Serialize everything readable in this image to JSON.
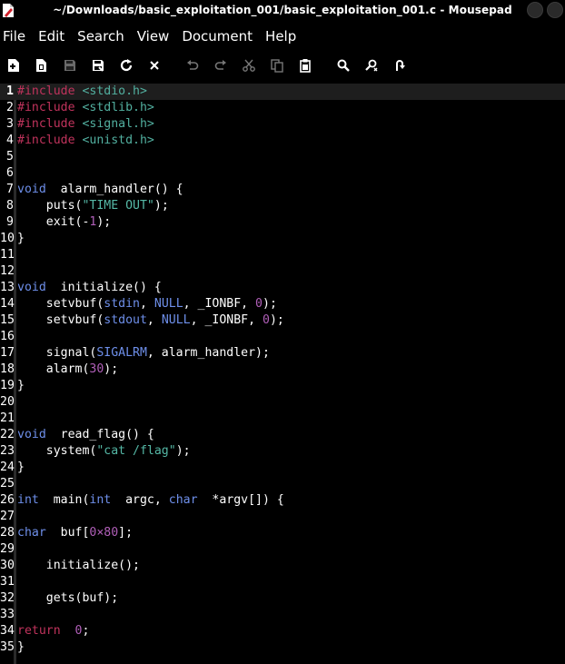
{
  "window": {
    "title": "~/Downloads/basic_exploitation_001/basic_exploitation_001.c - Mousepad"
  },
  "menu": [
    "File",
    "Edit",
    "Search",
    "View",
    "Document",
    "Help"
  ],
  "toolbar": {
    "buttons": [
      {
        "name": "new-document-icon"
      },
      {
        "name": "open-file-icon"
      },
      {
        "name": "save-icon"
      },
      {
        "name": "save-as-icon"
      },
      {
        "name": "reload-icon"
      },
      {
        "name": "close-icon"
      },
      {
        "name": "undo-icon"
      },
      {
        "name": "redo-icon"
      },
      {
        "name": "cut-icon"
      },
      {
        "name": "copy-icon"
      },
      {
        "name": "paste-icon"
      },
      {
        "name": "find-icon"
      },
      {
        "name": "find-replace-icon"
      },
      {
        "name": "go-to-line-icon"
      }
    ]
  },
  "editor": {
    "current_line": 1,
    "lines": [
      [
        [
          "pre",
          "#include "
        ],
        [
          "inc",
          "<stdio.h>"
        ]
      ],
      [
        [
          "pre",
          "#include "
        ],
        [
          "inc",
          "<stdlib.h>"
        ]
      ],
      [
        [
          "pre",
          "#include "
        ],
        [
          "inc",
          "<signal.h>"
        ]
      ],
      [
        [
          "pre",
          "#include "
        ],
        [
          "inc",
          "<unistd.h>"
        ]
      ],
      [],
      [],
      [
        [
          "kw",
          "void"
        ],
        [
          "",
          "  alarm_handler() {"
        ]
      ],
      [
        [
          "",
          "    puts("
        ],
        [
          "str",
          "\"TIME OUT\""
        ],
        [
          "",
          ");"
        ]
      ],
      [
        [
          "",
          "    exit(-"
        ],
        [
          "num",
          "1"
        ],
        [
          "",
          ");"
        ]
      ],
      [
        [
          "",
          "}"
        ]
      ],
      [],
      [],
      [
        [
          "kw",
          "void"
        ],
        [
          "",
          "  initialize() {"
        ]
      ],
      [
        [
          "",
          "    setvbuf("
        ],
        [
          "kw",
          "stdin"
        ],
        [
          "",
          ", "
        ],
        [
          "kw",
          "NULL"
        ],
        [
          "",
          ", _IONBF, "
        ],
        [
          "num",
          "0"
        ],
        [
          "",
          ");"
        ]
      ],
      [
        [
          "",
          "    setvbuf("
        ],
        [
          "kw",
          "stdout"
        ],
        [
          "",
          ", "
        ],
        [
          "kw",
          "NULL"
        ],
        [
          "",
          ", _IONBF, "
        ],
        [
          "num",
          "0"
        ],
        [
          "",
          ");"
        ]
      ],
      [],
      [
        [
          "",
          "    signal("
        ],
        [
          "kw",
          "SIGALRM"
        ],
        [
          "",
          ", alarm_handler);"
        ]
      ],
      [
        [
          "",
          "    alarm("
        ],
        [
          "num",
          "30"
        ],
        [
          "",
          ");"
        ]
      ],
      [
        [
          "",
          "}"
        ]
      ],
      [],
      [],
      [
        [
          "kw",
          "void"
        ],
        [
          "",
          "  read_flag() {"
        ]
      ],
      [
        [
          "",
          "    system("
        ],
        [
          "str",
          "\"cat /flag\""
        ],
        [
          "",
          ");"
        ]
      ],
      [
        [
          "",
          "}"
        ]
      ],
      [],
      [
        [
          "kw",
          "int"
        ],
        [
          "",
          "  main("
        ],
        [
          "kw",
          "int"
        ],
        [
          "",
          "  argc, "
        ],
        [
          "kw",
          "char"
        ],
        [
          "",
          "  *argv[]) {"
        ]
      ],
      [],
      [
        [
          "    ",
          ""
        ],
        [
          "kw",
          "char"
        ],
        [
          "",
          "  buf["
        ],
        [
          "num",
          "0×80"
        ],
        [
          "",
          "];"
        ]
      ],
      [],
      [
        [
          "",
          "    initialize();"
        ]
      ],
      [],
      [
        [
          "",
          "    gets(buf);"
        ]
      ],
      [],
      [
        [
          "    ",
          ""
        ],
        [
          "ret",
          "return"
        ],
        [
          "",
          "  "
        ],
        [
          "num",
          "0"
        ],
        [
          "",
          ";"
        ]
      ],
      [
        [
          "",
          "}"
        ]
      ]
    ]
  },
  "colors": {
    "background": "#000000",
    "preprocessor": "#c0335c",
    "include": "#52b0a0",
    "keyword": "#6e8fea",
    "string": "#55b8a6",
    "number": "#b05fb8"
  }
}
